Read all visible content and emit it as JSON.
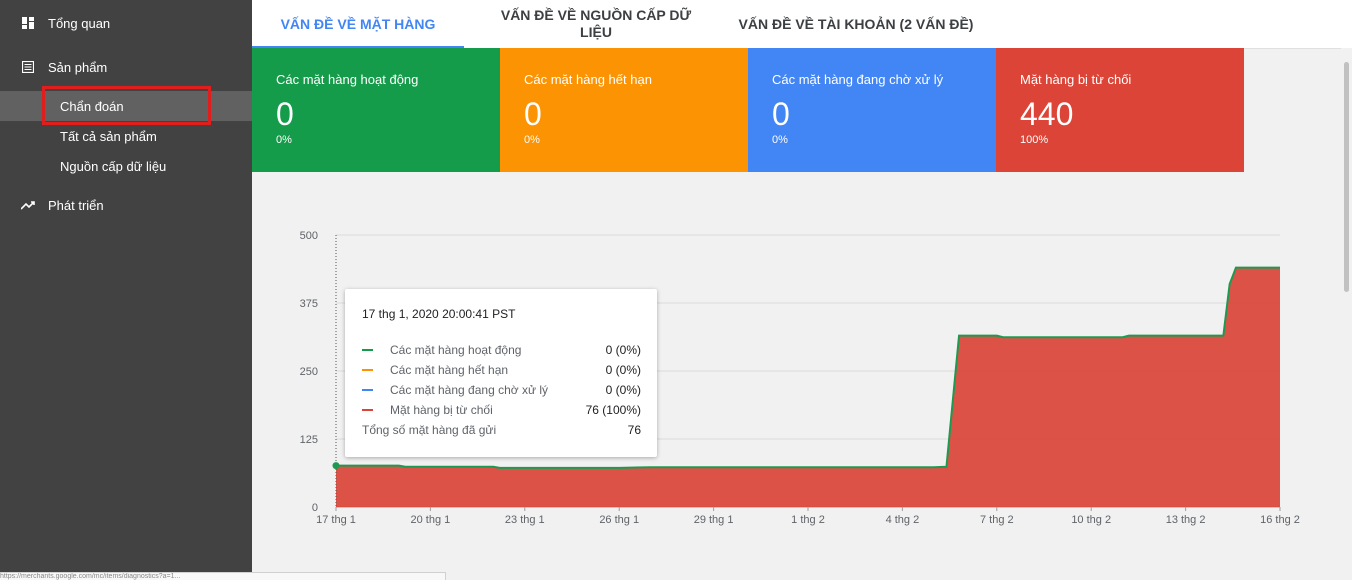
{
  "sidebar": {
    "items": [
      {
        "label": "Tổng quan",
        "icon": "dashboard-icon"
      },
      {
        "label": "Sản phẩm",
        "icon": "list-icon"
      },
      {
        "label": "Phát triển",
        "icon": "trending-up-icon"
      }
    ],
    "subitems": [
      {
        "label": "Chẩn đoán",
        "active": true
      },
      {
        "label": "Tất cả sản phẩm"
      },
      {
        "label": "Nguồn cấp dữ liệu"
      }
    ]
  },
  "tabs": [
    {
      "label": "Vấn đề về mặt hàng",
      "active": true
    },
    {
      "label": "Vấn đề về nguồn cấp dữ liệu"
    },
    {
      "label": "Vấn đề về tài khoản (2 vấn đề)"
    }
  ],
  "cards": [
    {
      "title": "Các mặt hàng hoạt động",
      "value": "0",
      "percent": "0%",
      "color": "#159c4a"
    },
    {
      "title": "Các mặt hàng hết hạn",
      "value": "0",
      "percent": "0%",
      "color": "#fb9302"
    },
    {
      "title": "Các mặt hàng đang chờ xử lý",
      "value": "0",
      "percent": "0%",
      "color": "#4285f4"
    },
    {
      "title": "Mặt hàng bị từ chối",
      "value": "440",
      "percent": "100%",
      "color": "#db4437"
    }
  ],
  "tooltip": {
    "title": "17 thg 1, 2020 20:00:41 PST",
    "rows": [
      {
        "name": "Các mặt hàng hoạt động",
        "value": "0 (0%)",
        "color": "#159c4a"
      },
      {
        "name": "Các mặt hàng hết hạn",
        "value": "0 (0%)",
        "color": "#fb9302"
      },
      {
        "name": "Các mặt hàng đang chờ xử lý",
        "value": "0 (0%)",
        "color": "#4285f4"
      },
      {
        "name": "Mặt hàng bị từ chối",
        "value": "76 (100%)",
        "color": "#db4437"
      }
    ],
    "total_label": "Tổng số mặt hàng đã gửi",
    "total_value": "76"
  },
  "chart_data": {
    "type": "area",
    "x_ticks": [
      "17 thg 1",
      "20 thg 1",
      "23 thg 1",
      "26 thg 1",
      "29 thg 1",
      "1 thg 2",
      "4 thg 2",
      "7 thg 2",
      "10 thg 2",
      "13 thg 2",
      "16 thg 2"
    ],
    "y_ticks": [
      "0",
      "125",
      "250",
      "375",
      "500"
    ],
    "ylim": [
      0,
      500
    ],
    "x_range_days": [
      0,
      30
    ],
    "grid": true,
    "series": [
      {
        "name": "Mặt hàng bị từ chối",
        "color": "#db4437",
        "points": [
          [
            0,
            76
          ],
          [
            2,
            76
          ],
          [
            2.2,
            74
          ],
          [
            5,
            74
          ],
          [
            5.2,
            72
          ],
          [
            9,
            72
          ],
          [
            10,
            73
          ],
          [
            13,
            73
          ],
          [
            14,
            73
          ],
          [
            19,
            73
          ],
          [
            19.4,
            74
          ],
          [
            19.8,
            315
          ],
          [
            21,
            315
          ],
          [
            21.2,
            312
          ],
          [
            25,
            312
          ],
          [
            25.2,
            315
          ],
          [
            28,
            315
          ],
          [
            28.2,
            315
          ],
          [
            28.4,
            410
          ],
          [
            28.6,
            440
          ],
          [
            30,
            440
          ]
        ]
      },
      {
        "name": "Các mặt hàng hoạt động",
        "color": "#159c4a",
        "points": [
          [
            0,
            0
          ],
          [
            30,
            0
          ]
        ]
      }
    ]
  },
  "statusbar": {
    "text": "https://merchants.google.com/mc/items/diagnostics?a=1..."
  }
}
